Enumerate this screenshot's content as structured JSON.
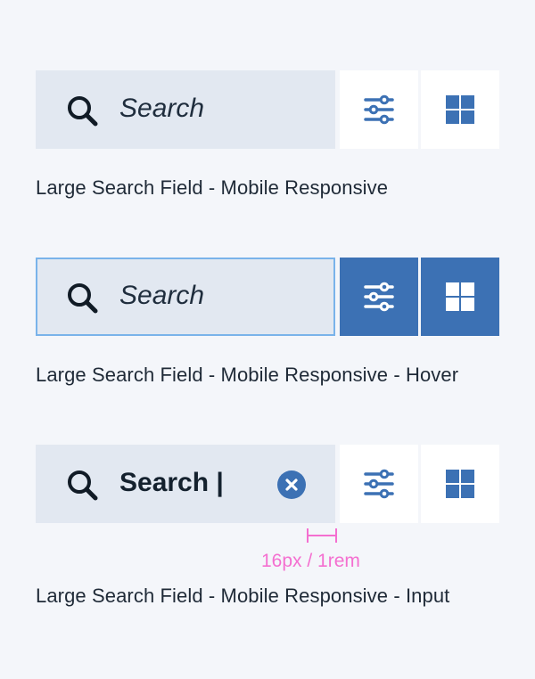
{
  "colors": {
    "page_bg": "#f4f6fa",
    "field_bg": "#e2e8f1",
    "field_hover_border": "#79b3ea",
    "accent_blue": "#3c71b4",
    "text_dark": "#1f2d3d",
    "annotation_pink": "#f46fd0"
  },
  "variants": [
    {
      "search": {
        "placeholder": "Search",
        "icon": "search-icon"
      },
      "filter_button": {
        "icon": "sliders-icon"
      },
      "grid_button": {
        "icon": "grid-icon"
      },
      "caption": "Large Search Field - Mobile Responsive"
    },
    {
      "search": {
        "placeholder": "Search",
        "icon": "search-icon"
      },
      "filter_button": {
        "icon": "sliders-icon"
      },
      "grid_button": {
        "icon": "grid-icon"
      },
      "caption": "Large Search Field - Mobile Responsive - Hover"
    },
    {
      "search": {
        "value": "Search |",
        "icon": "search-icon",
        "clear_icon": "clear-circle-icon"
      },
      "filter_button": {
        "icon": "sliders-icon"
      },
      "grid_button": {
        "icon": "grid-icon"
      },
      "caption": "Large Search Field - Mobile Responsive - Input"
    }
  ],
  "spacing_annotation": {
    "label": "16px / 1rem"
  }
}
